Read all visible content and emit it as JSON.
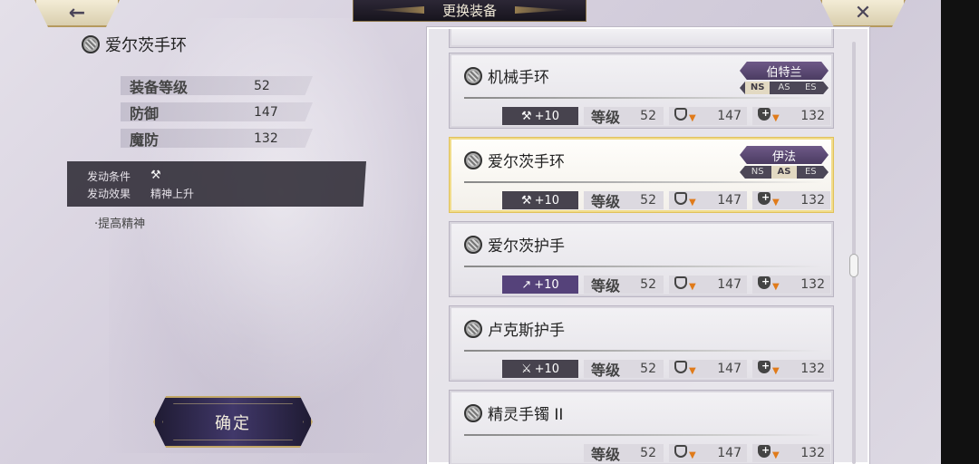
{
  "header": {
    "title": "更换装备",
    "back_label": "←",
    "close_label": "✕"
  },
  "left": {
    "item_name": "爱尔茨手环",
    "stats": [
      {
        "label": "装备等级",
        "value": "52"
      },
      {
        "label": "防御",
        "value": "147"
      },
      {
        "label": "魔防",
        "value": "132"
      }
    ],
    "effect": {
      "cond_label": "发动条件",
      "cond_icon": "hammer-icon",
      "effect_label": "发动效果",
      "effect_value": "精神上升"
    },
    "note": "·提高精神",
    "confirm_label": "确定"
  },
  "list": [
    {
      "name": "机械手环",
      "badge": "伯特兰",
      "series": [
        "NS",
        "AS",
        "ES"
      ],
      "active_series": "NS",
      "plus": "+10",
      "plus_icon": "hammer-icon",
      "level_label": "等级",
      "level": "52",
      "def": "147",
      "mdef": "132"
    },
    {
      "name": "爱尔茨手环",
      "badge": "伊法",
      "series": [
        "NS",
        "AS",
        "ES"
      ],
      "active_series": "AS",
      "plus": "+10",
      "plus_icon": "hammer-icon",
      "level_label": "等级",
      "level": "52",
      "def": "147",
      "mdef": "132",
      "selected": true
    },
    {
      "name": "爱尔茨护手",
      "plus": "+10",
      "plus_icon": "arrow-icon",
      "level_label": "等级",
      "level": "52",
      "def": "147",
      "mdef": "132"
    },
    {
      "name": "卢克斯护手",
      "plus": "+10",
      "plus_icon": "sword-icon",
      "level_label": "等级",
      "level": "52",
      "def": "147",
      "mdef": "132"
    },
    {
      "name": "精灵手镯 II",
      "level_label": "等级",
      "level": "52",
      "def": "147",
      "mdef": "132"
    }
  ],
  "colors": {
    "accent_gold": "#c2a766",
    "selected_border": "#e1c15b",
    "badge_purple": "#5b4872",
    "defense_arrow": "#e07b1a"
  }
}
